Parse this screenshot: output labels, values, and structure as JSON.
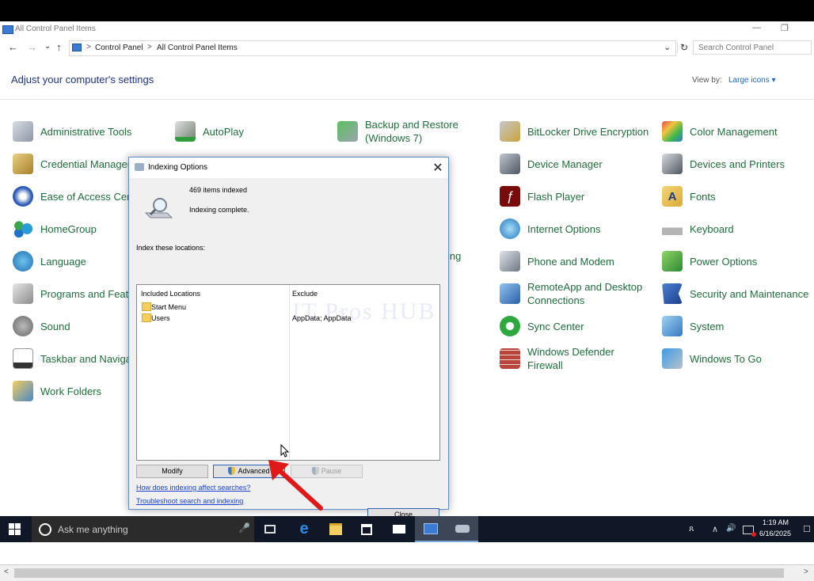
{
  "window": {
    "title": "All Control Panel Items",
    "minimize_glyph": "—",
    "restore_glyph": "❐"
  },
  "nav": {
    "back_glyph": "←",
    "forward_glyph": "→",
    "recent_glyph": "⌄",
    "up_glyph": "↑",
    "breadcrumb": [
      "Control Panel",
      "All Control Panel Items"
    ],
    "breadcrumb_sep": ">",
    "dropdown_glyph": "⌄",
    "refresh_glyph": "↻",
    "search_placeholder": "Search Control Panel"
  },
  "heading": "Adjust your computer's settings",
  "view_by": {
    "label": "View by:",
    "value": "Large icons",
    "arrow": "▾"
  },
  "items": {
    "administrative_tools": "Administrative Tools",
    "autoplay": "AutoPlay",
    "backup_restore": "Backup and Restore (Windows 7)",
    "bitlocker": "BitLocker Drive Encryption",
    "color_management": "Color Management",
    "credential_manager": "Credential Manager",
    "device_manager": "Device Manager",
    "devices_printers": "Devices and Printers",
    "ease_of_access": "Ease of Access Cent",
    "flash_player": "Flash Player",
    "fonts": "Fonts",
    "homegroup": "HomeGroup",
    "internet_options": "Internet Options",
    "keyboard": "Keyboard",
    "language": "Language",
    "indexing_partial": "ing",
    "phone_modem": "Phone and Modem",
    "power_options": "Power Options",
    "programs_features": "Programs and Featu",
    "remoteapp": "RemoteApp and Desktop Connections",
    "security_maintenance": "Security and Maintenance",
    "sound": "Sound",
    "sync_center": "Sync Center",
    "system": "System",
    "taskbar_navigation": "Taskbar and Naviga",
    "windows_defender": "Windows Defender Firewall",
    "windows_to_go": "Windows To Go",
    "work_folders": "Work Folders"
  },
  "dialog": {
    "title": "Indexing Options",
    "close_glyph": "✕",
    "items_indexed": "469 items indexed",
    "status": "Indexing complete.",
    "index_locations_label": "Index these locations:",
    "columns": {
      "included": "Included Locations",
      "exclude": "Exclude"
    },
    "locations": [
      {
        "name": "Start Menu",
        "exclude": ""
      },
      {
        "name": "Users",
        "exclude": "AppData; AppData"
      }
    ],
    "buttons": {
      "modify": "Modify",
      "advanced": "Advanced",
      "pause": "Pause",
      "close": "Close"
    },
    "links": {
      "how_indexing": "How does indexing affect searches?",
      "troubleshoot": "Troubleshoot search and indexing"
    }
  },
  "taskbar": {
    "search_placeholder": "Ask me anything",
    "mic_glyph": "🎤",
    "time": "1:19 AM",
    "date": "6/16/2025",
    "tray_people": "ጸ",
    "tray_up": "∧",
    "tray_volume": "🔊",
    "tray_notification": "☐"
  },
  "scrollbar": {
    "left": "<",
    "right": ">"
  },
  "colors": {
    "accent_link": "#1a3fd0",
    "item_green": "#1e6e3c",
    "heading_blue": "#1e3287",
    "arrow_red": "#e01818",
    "taskbar": "#101827"
  }
}
